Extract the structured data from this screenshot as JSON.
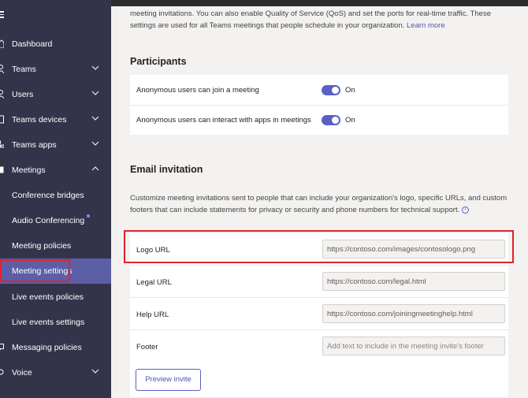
{
  "sidebar": {
    "items": [
      {
        "label": "Dashboard",
        "icon": "home-icon"
      },
      {
        "label": "Teams",
        "icon": "teams-icon"
      },
      {
        "label": "Users",
        "icon": "users-icon"
      },
      {
        "label": "Teams devices",
        "icon": "devices-icon"
      },
      {
        "label": "Teams apps",
        "icon": "apps-icon"
      },
      {
        "label": "Meetings",
        "icon": "calendar-icon"
      },
      {
        "label": "Conference bridges"
      },
      {
        "label": "Audio Conferencing"
      },
      {
        "label": "Meeting policies"
      },
      {
        "label": "Meeting settings"
      },
      {
        "label": "Live events policies"
      },
      {
        "label": "Live events settings"
      },
      {
        "label": "Messaging policies",
        "icon": "messaging-icon"
      },
      {
        "label": "Voice",
        "icon": "voice-icon"
      }
    ]
  },
  "main": {
    "intro_text": "meeting invitations. You can also enable Quality of Service (QoS) and set the ports for real-time traffic. These settings are used for all Teams meetings that people schedule in your organization.",
    "learn_more": "Learn more",
    "participants": {
      "title": "Participants",
      "rows": [
        {
          "label": "Anonymous users can join a meeting",
          "state": "On"
        },
        {
          "label": "Anonymous users can interact with apps in meetings",
          "state": "On"
        }
      ]
    },
    "email_invitation": {
      "title": "Email invitation",
      "description": "Customize meeting invitations sent to people that can include your organization's logo, specific URLs, and custom footers that can include statements for privacy or security and phone numbers for technical support.",
      "fields": [
        {
          "label": "Logo URL",
          "value": "https://contoso.com/images/contosologo.png"
        },
        {
          "label": "Legal URL",
          "value": "https://contoso.com/legal.html"
        },
        {
          "label": "Help URL",
          "value": "https://contoso.com/joiningmeetinghelp.html"
        },
        {
          "label": "Footer",
          "placeholder": "Add text to include in the meeting invite's footer"
        }
      ],
      "preview_button": "Preview invite"
    }
  },
  "colors": {
    "sidebar_bg": "#33344a",
    "active_bg": "#5c5fa5",
    "accent": "#5b5fc7",
    "highlight": "#e0222b"
  }
}
